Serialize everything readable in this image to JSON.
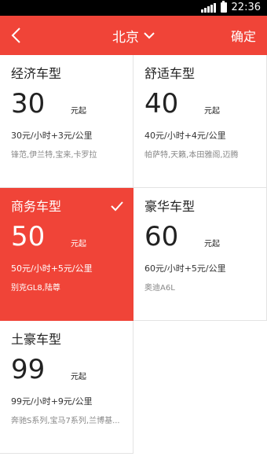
{
  "status": {
    "time": "22:36"
  },
  "nav": {
    "city": "北京",
    "confirm": "确定"
  },
  "cards": [
    {
      "name": "经济车型",
      "price": "30",
      "unit": "元起",
      "rate": "30元/小时+3元/公里",
      "models": "锋范,伊兰特,宝来,卡罗拉"
    },
    {
      "name": "舒适车型",
      "price": "40",
      "unit": "元起",
      "rate": "40元/小时+4元/公里",
      "models": "帕萨特,天籁,本田雅阁,迈腾"
    },
    {
      "name": "商务车型",
      "price": "50",
      "unit": "元起",
      "rate": "50元/小时+5元/公里",
      "models": "别克GL8,陆尊",
      "selected": true
    },
    {
      "name": "豪华车型",
      "price": "60",
      "unit": "元起",
      "rate": "60元/小时+5元/公里",
      "models": "奥迪A6L"
    },
    {
      "name": "土豪车型",
      "price": "99",
      "unit": "元起",
      "rate": "99元/小时+9元/公里",
      "models": "奔驰S系列,宝马7系列,兰博基..."
    }
  ],
  "colors": {
    "accent": "#f04438"
  }
}
